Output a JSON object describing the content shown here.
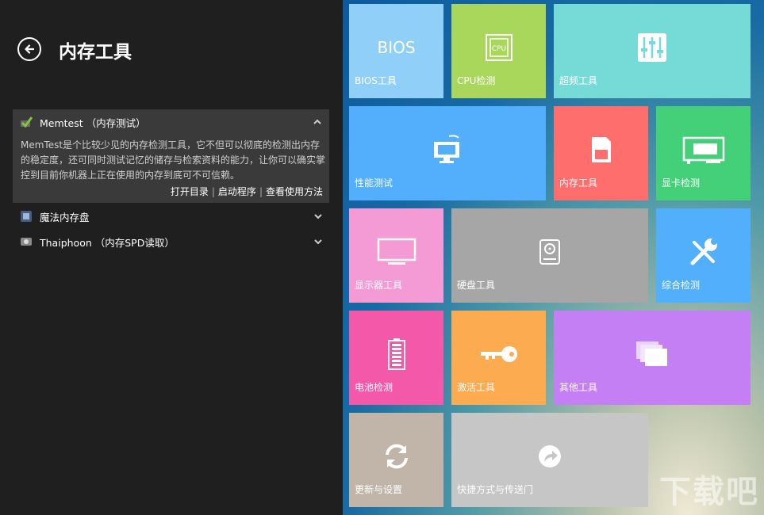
{
  "header": {
    "title": "内存工具"
  },
  "tools": [
    {
      "name": "Memtest （内存测试）",
      "icon": "memtest-icon",
      "expanded": true,
      "description": "MemTest是个比较少见的内存检测工具，它不但可以彻底的检测出内存的稳定度，还可同时测试记忆的储存与检索资料的能力，让你可以确实掌控到目前你机器上正在使用的内存到底可不可信赖。",
      "links": [
        "打开目录",
        "启动程序",
        "查看使用方法"
      ],
      "separator": "|"
    },
    {
      "name": "魔法内存盘",
      "icon": "ramdisk-icon",
      "expanded": false
    },
    {
      "name": "Thaiphoon （内存SPD读取）",
      "icon": "thaiphoon-icon",
      "expanded": false
    }
  ],
  "tiles": [
    {
      "id": "bios",
      "label": "BIOS工具",
      "icon_text": "BIOS",
      "color": "#8fcff8"
    },
    {
      "id": "cpu",
      "label": "CPU检测",
      "icon_text": "CPU",
      "color": "#a9d75c"
    },
    {
      "id": "overclock",
      "label": "超频工具",
      "color": "#76dad6"
    },
    {
      "id": "performance",
      "label": "性能测试",
      "color": "#53aefb"
    },
    {
      "id": "memory",
      "label": "内存工具",
      "color": "#fe6e6c"
    },
    {
      "id": "gpu",
      "label": "显卡检测",
      "color": "#44d079"
    },
    {
      "id": "monitor",
      "label": "显示器工具",
      "color": "#f49ad4"
    },
    {
      "id": "disk",
      "label": "硬盘工具",
      "color": "#a6a6a6"
    },
    {
      "id": "general",
      "label": "综合检测",
      "color": "#52affb"
    },
    {
      "id": "battery",
      "label": "电池检测",
      "color": "#f358a9"
    },
    {
      "id": "activate",
      "label": "激活工具",
      "color": "#fdab50"
    },
    {
      "id": "other",
      "label": "其他工具",
      "color": "#c47ff4"
    },
    {
      "id": "update",
      "label": "更新与设置",
      "color": "#c0b5a8"
    },
    {
      "id": "shortcut",
      "label": "快捷方式与传送门",
      "color": "#c6c6c6"
    }
  ],
  "watermark": "下载吧"
}
